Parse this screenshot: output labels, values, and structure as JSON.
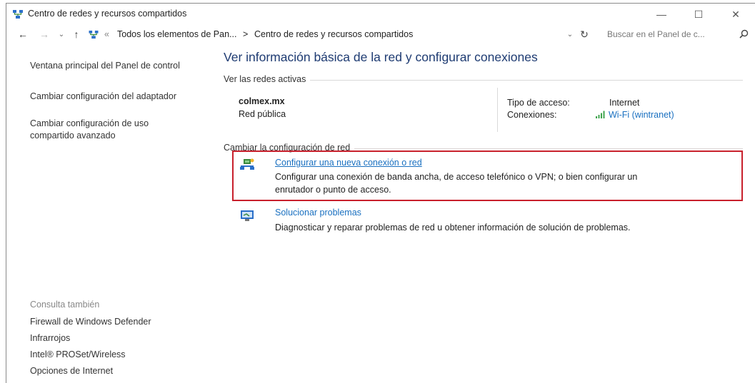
{
  "window": {
    "title": "Centro de redes y recursos compartidos",
    "controls": [
      "—",
      "☐",
      "✕"
    ]
  },
  "address_bar": {
    "separator": "«",
    "crumb_1": "Todos los elementos de Pan...",
    "arrow": ">",
    "crumb_2": "Centro de redes y recursos compartidos",
    "search_placeholder": "Buscar en el Panel de c..."
  },
  "sidebar": {
    "links": [
      "Ventana principal del Panel de control",
      "Cambiar configuración del adaptador",
      "Cambiar configuración de uso compartido avanzado"
    ],
    "see_also_title": "Consulta también",
    "see_also": [
      "Firewall de Windows Defender",
      "Infrarrojos",
      "Intel® PROSet/Wireless",
      "Opciones de Internet"
    ]
  },
  "main": {
    "title": "Ver información básica de la red y configurar conexiones",
    "active_networks_label": "Ver las redes activas",
    "network": {
      "name": "colmex.mx",
      "type": "Red pública",
      "access_label": "Tipo de acceso:",
      "access_value": "Internet",
      "connections_label": "Conexiones:",
      "connections_value": "Wi-Fi (wintranet)"
    },
    "change_settings_label": "Cambiar la configuración de red",
    "tasks": [
      {
        "link": "Configurar una nueva conexión o red",
        "desc_line1": "Configurar una conexión de banda ancha, de acceso telefónico o VPN; o bien configurar un",
        "desc_line2": "enrutador o punto de acceso."
      },
      {
        "link": "Solucionar problemas",
        "desc_line1": "Diagnosticar y reparar problemas de red u obtener información de solución de problemas."
      }
    ]
  },
  "colors": {
    "title": "#1e3b72",
    "link": "#1a70c0",
    "highlight": "#c8202c"
  }
}
